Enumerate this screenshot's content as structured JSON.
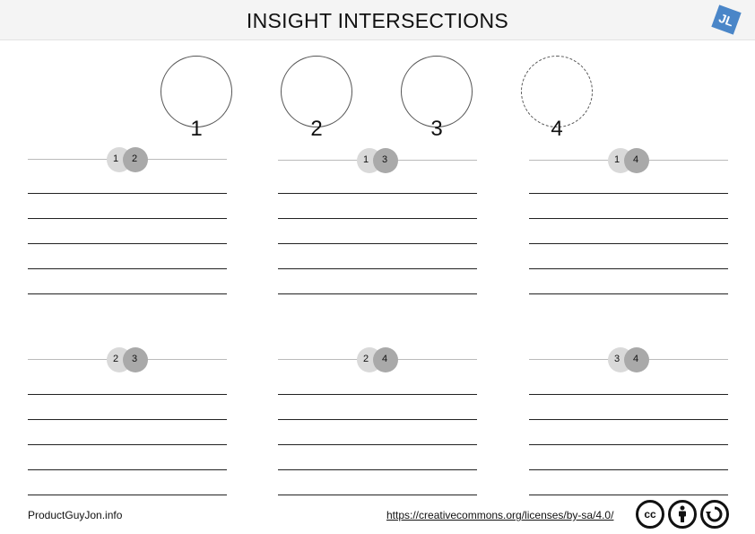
{
  "header": {
    "title": "INSIGHT INTERSECTIONS",
    "logo_text": "JL"
  },
  "circles": [
    {
      "label": "1",
      "style": "solid"
    },
    {
      "label": "2",
      "style": "solid"
    },
    {
      "label": "3",
      "style": "solid"
    },
    {
      "label": "4",
      "style": "dashed"
    }
  ],
  "pairs": [
    {
      "a": "1",
      "b": "2"
    },
    {
      "a": "1",
      "b": "3"
    },
    {
      "a": "1",
      "b": "4"
    },
    {
      "a": "2",
      "b": "3"
    },
    {
      "a": "2",
      "b": "4"
    },
    {
      "a": "3",
      "b": "4"
    }
  ],
  "footer": {
    "left": "ProductGuyJon.info",
    "right": "https://creativecommons.org/licenses/by-sa/4.0/",
    "cc_icon": "cc-icon",
    "by_icon": "attribution-icon",
    "sa_icon": "share-alike-icon"
  }
}
